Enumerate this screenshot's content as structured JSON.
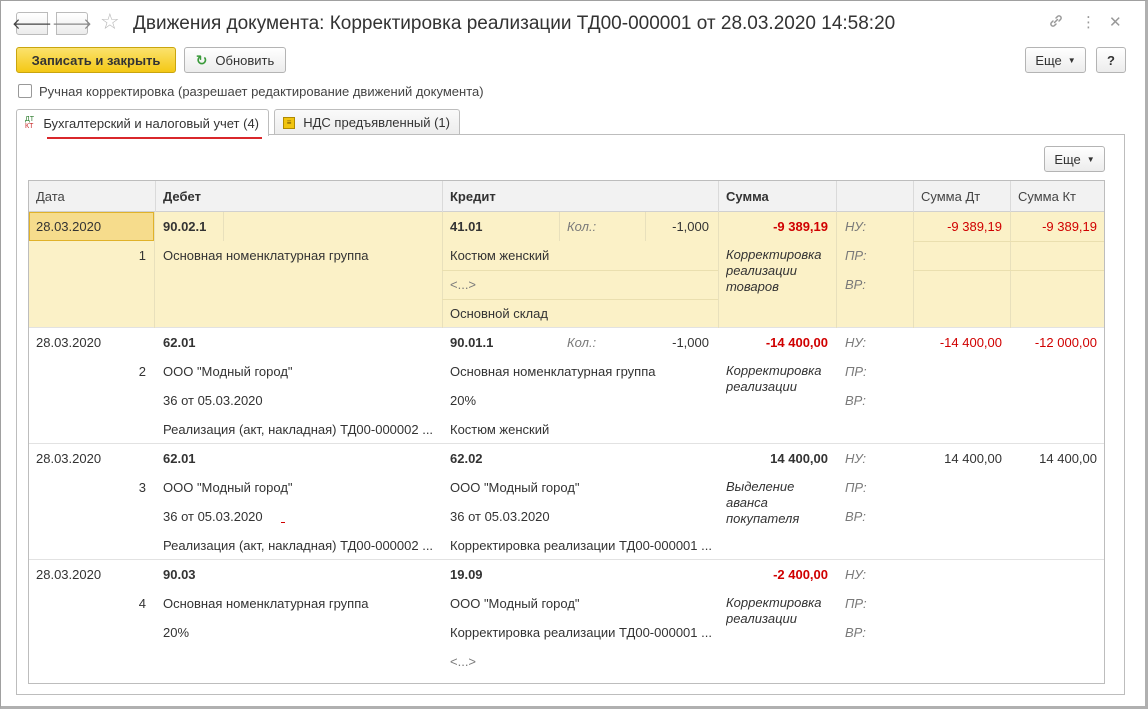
{
  "window": {
    "title": "Движения документа: Корректировка реализации ТД00-000001 от 28.03.2020 14:58:20"
  },
  "toolbar": {
    "save_close": "Записать и закрыть",
    "refresh": "Обновить",
    "more": "Еще",
    "help": "?"
  },
  "manual_checkbox": {
    "label": "Ручная корректировка (разрешает редактирование движений документа)",
    "checked": false
  },
  "tabs": [
    {
      "label": "Бухгалтерский и налоговый учет (4)",
      "icon": "dt-kt-icon",
      "active": true
    },
    {
      "label": "НДС предъявленный (1)",
      "icon": "vat-icon",
      "active": false
    }
  ],
  "panel": {
    "more": "Еще"
  },
  "grid": {
    "headers": {
      "date": "Дата",
      "debit": "Дебет",
      "credit": "Кредит",
      "sum": "Сумма",
      "sum_dt": "Сумма Дт",
      "sum_kt": "Сумма Кт"
    },
    "rows": [
      {
        "date": "28.03.2020",
        "num": "1",
        "debit_account": "90.02.1",
        "debit_lines": [
          "Основная номенклатурная группа"
        ],
        "credit_account": "41.01",
        "qty_label": "Кол.:",
        "qty": "-1,000",
        "credit_lines": [
          "Костюм женский",
          "<...>",
          "Основной склад"
        ],
        "sum": "-9 389,19",
        "note": "Корректировка реализации товаров",
        "nu": "НУ:",
        "pr": "ПР:",
        "vr": "ВР:",
        "sum_dt": "-9 389,19",
        "sum_kt": "-9 389,19"
      },
      {
        "date": "28.03.2020",
        "num": "2",
        "debit_account": "62.01",
        "debit_lines": [
          "ООО \"Модный город\"",
          "36 от 05.03.2020",
          "Реализация (акт, накладная) ТД00-000002 ..."
        ],
        "credit_account": "90.01.1",
        "qty_label": "Кол.:",
        "qty": "-1,000",
        "credit_lines": [
          "Основная номенклатурная группа",
          "20%",
          "Костюм женский"
        ],
        "sum": "-14 400,00",
        "note": "Корректировка реализации",
        "nu": "НУ:",
        "pr": "ПР:",
        "vr": "ВР:",
        "sum_dt": "-14 400,00",
        "sum_kt": "-12 000,00"
      },
      {
        "date": "28.03.2020",
        "num": "3",
        "debit_account": "62.01",
        "debit_lines": [
          "ООО \"Модный город\"",
          "36 от 05.03.2020",
          "Реализация (акт, накладная) ТД00-000002 ..."
        ],
        "credit_account": "62.02",
        "qty_label": "",
        "qty": "",
        "credit_lines": [
          "ООО \"Модный город\"",
          "36 от 05.03.2020",
          "Корректировка реализации ТД00-000001 ..."
        ],
        "sum": "14 400,00",
        "note": "Выделение аванса покупателя",
        "nu": "НУ:",
        "pr": "ПР:",
        "vr": "ВР:",
        "sum_dt": "14 400,00",
        "sum_kt": "14 400,00"
      },
      {
        "date": "28.03.2020",
        "num": "4",
        "debit_account": "90.03",
        "debit_lines": [
          "Основная номенклатурная группа",
          "20%"
        ],
        "credit_account": "19.09",
        "qty_label": "",
        "qty": "",
        "credit_lines": [
          "ООО \"Модный город\"",
          "Корректировка реализации ТД00-000001 ...",
          "<...>"
        ],
        "sum": "-2 400,00",
        "note": "Корректировка реализации",
        "nu": "НУ:",
        "pr": "ПР:",
        "vr": "ВР:",
        "sum_dt": "",
        "sum_kt": ""
      }
    ]
  }
}
